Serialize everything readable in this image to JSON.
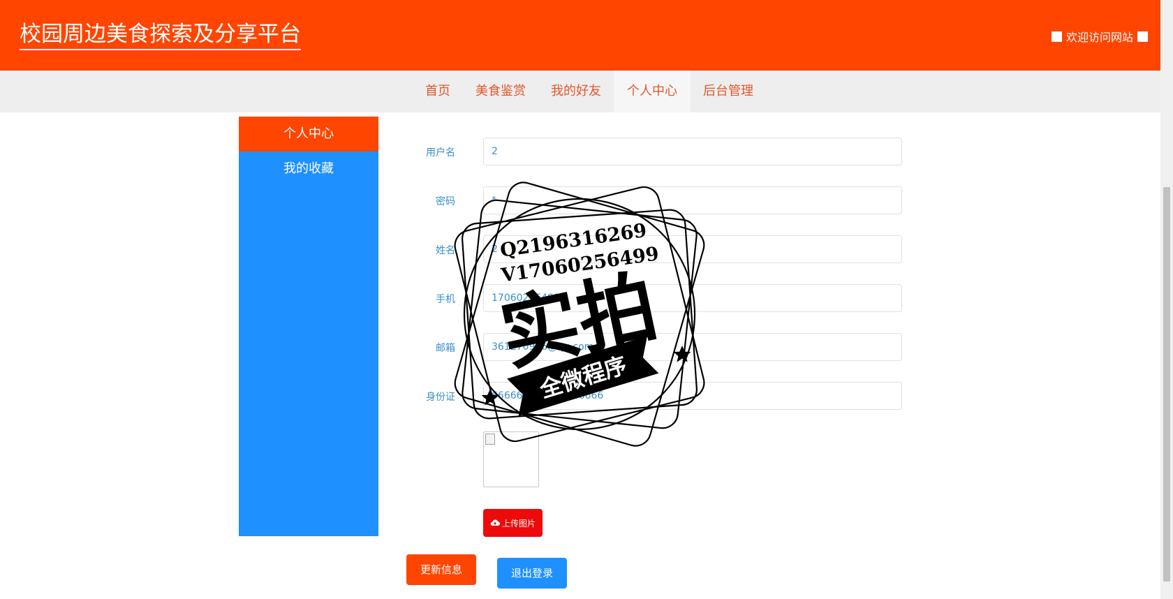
{
  "header": {
    "site_title": "校园周边美食探索及分享平台",
    "welcome": "欢迎访问网站"
  },
  "nav": {
    "items": [
      {
        "label": "首页"
      },
      {
        "label": "美食鉴赏"
      },
      {
        "label": "我的好友"
      },
      {
        "label": "个人中心",
        "active": true
      },
      {
        "label": "后台管理"
      }
    ]
  },
  "sidebar": {
    "items": [
      {
        "label": "个人中心",
        "active": true
      },
      {
        "label": "我的收藏"
      }
    ]
  },
  "form": {
    "fields": [
      {
        "label": "用户名",
        "value": "2"
      },
      {
        "label": "密码",
        "value": "*"
      },
      {
        "label": "姓名",
        "value": "2"
      },
      {
        "label": "手机",
        "value": "17060256499"
      },
      {
        "label": "邮箱",
        "value": "361270936@qq.com"
      },
      {
        "label": "身份证",
        "value": "666666666666666666"
      }
    ],
    "upload_label": "上传图片",
    "update_label": "更新信息",
    "logout_label": "退出登录"
  },
  "watermark": {
    "line1": "Q2196316269",
    "line2": "V17060256499",
    "big": "实拍",
    "banner": "全微程序"
  },
  "colors": {
    "primary": "#ff4500",
    "blue": "#1e90ff",
    "upload_red": "#ee0a0a"
  }
}
